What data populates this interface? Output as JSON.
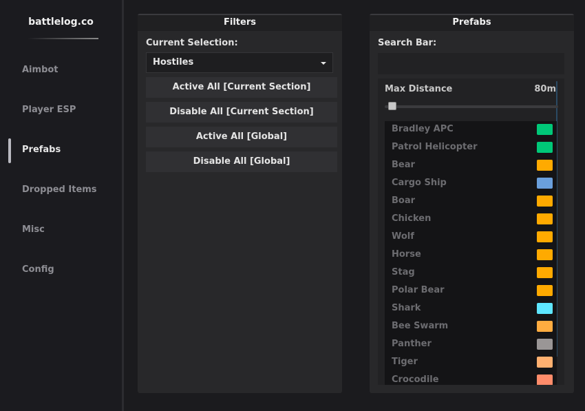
{
  "sidebar": {
    "brand": "battlelog.co",
    "items": [
      {
        "label": "Aimbot",
        "active": false
      },
      {
        "label": "Player ESP",
        "active": false
      },
      {
        "label": "Prefabs",
        "active": true
      },
      {
        "label": "Dropped Items",
        "active": false
      },
      {
        "label": "Misc",
        "active": false
      },
      {
        "label": "Config",
        "active": false
      }
    ]
  },
  "filters": {
    "title": "Filters",
    "selection_label": "Current Selection:",
    "selection_value": "Hostiles",
    "buttons": [
      "Active All [Current Section]",
      "Disable All [Current Section]",
      "Active All [Global]",
      "Disable All [Global]"
    ]
  },
  "prefabs": {
    "title": "Prefabs",
    "search_label": "Search Bar:",
    "search_value": "",
    "max_distance_label": "Max Distance",
    "max_distance_value": "80m",
    "max_distance_fraction": 0.02,
    "items": [
      {
        "name": "Bradley APC",
        "color": "#00c878"
      },
      {
        "name": "Patrol Helicopter",
        "color": "#00c878"
      },
      {
        "name": "Bear",
        "color": "#ffaa00"
      },
      {
        "name": "Cargo Ship",
        "color": "#6a9fdc"
      },
      {
        "name": "Boar",
        "color": "#ffaa00"
      },
      {
        "name": "Chicken",
        "color": "#ffaa00"
      },
      {
        "name": "Wolf",
        "color": "#ffaa00"
      },
      {
        "name": "Horse",
        "color": "#ffaa00"
      },
      {
        "name": "Stag",
        "color": "#ffaa00"
      },
      {
        "name": "Polar Bear",
        "color": "#ffaa00"
      },
      {
        "name": "Shark",
        "color": "#5ee6ff"
      },
      {
        "name": "Bee Swarm",
        "color": "#ffac40"
      },
      {
        "name": "Panther",
        "color": "#9a9696"
      },
      {
        "name": "Tiger",
        "color": "#ffb070"
      },
      {
        "name": "Crocodile",
        "color": "#ff8c6a"
      }
    ]
  }
}
